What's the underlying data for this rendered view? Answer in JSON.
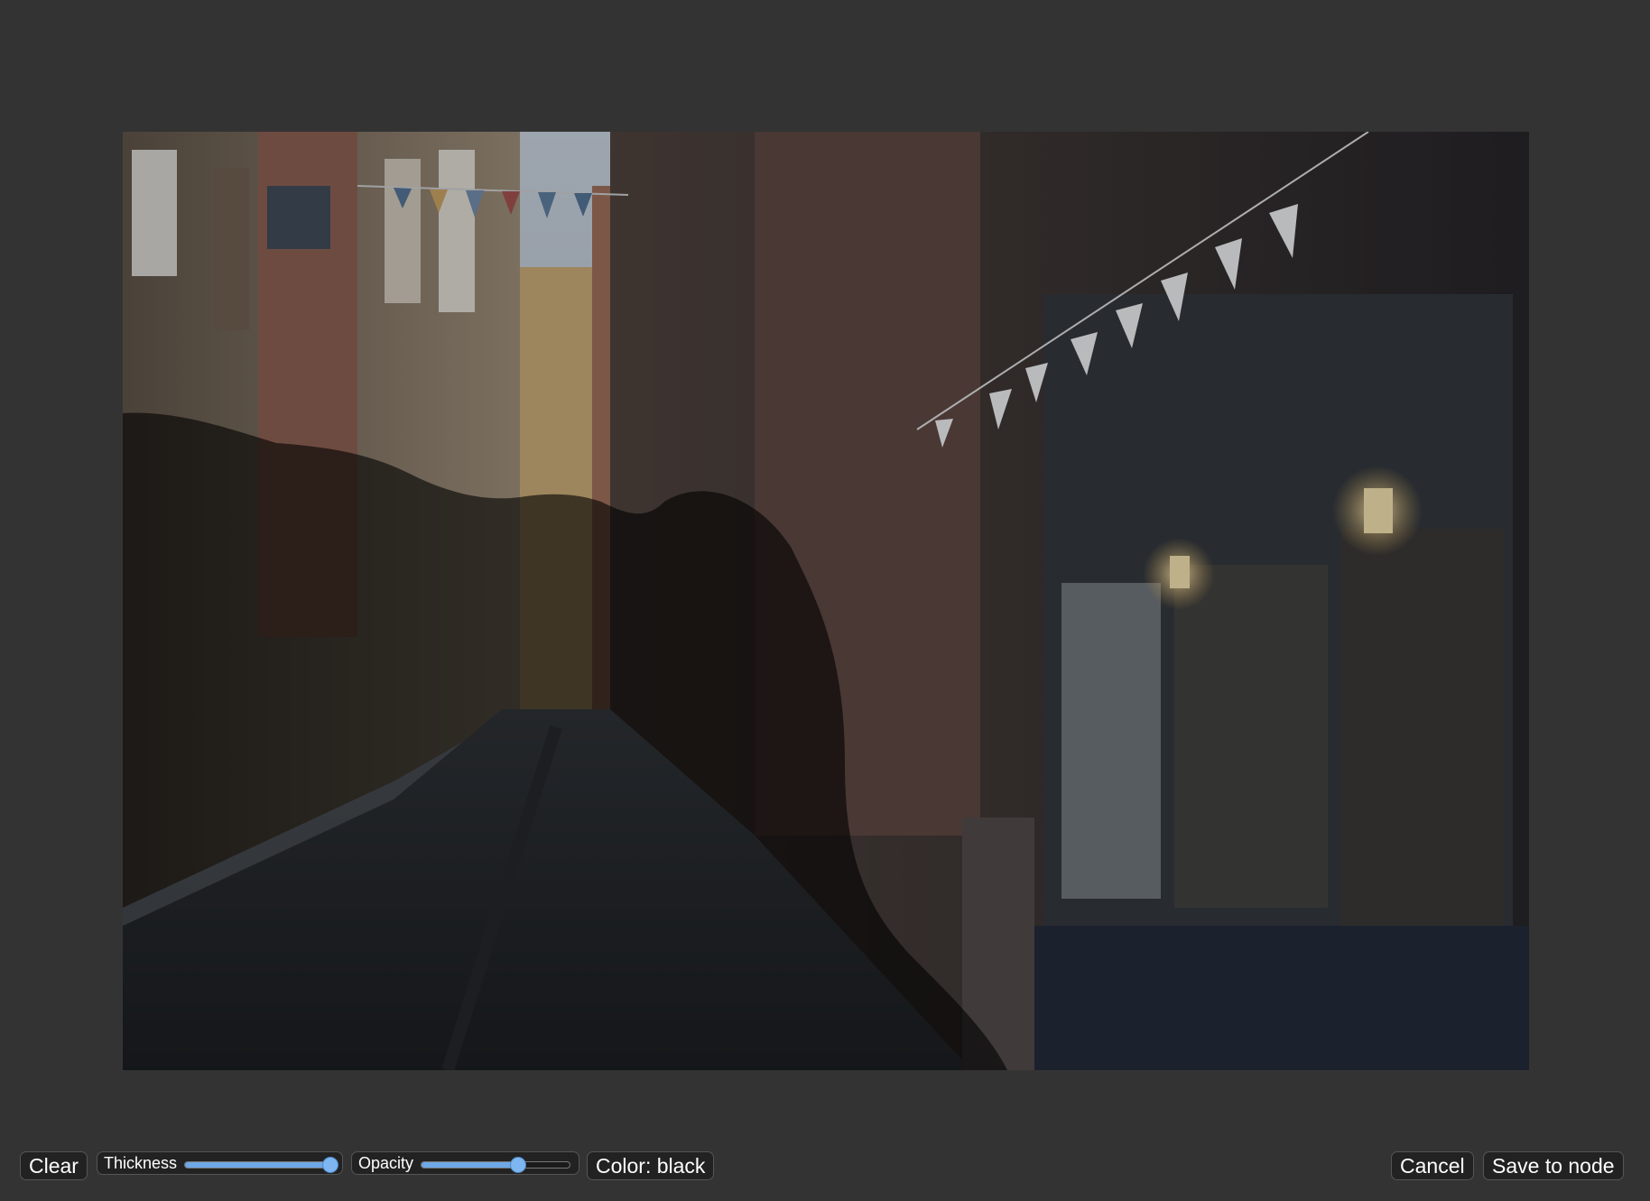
{
  "toolbar": {
    "clear_label": "Clear",
    "thickness": {
      "label": "Thickness",
      "value_fraction": 0.98
    },
    "opacity": {
      "label": "Opacity",
      "value_fraction": 0.65
    },
    "color_label": "Color: black",
    "cancel_label": "Cancel",
    "save_label": "Save to node"
  },
  "colors": {
    "background": "#333333",
    "button_bg": "#222222",
    "button_border": "#555555",
    "slider_fill": "#6ea8e6",
    "mask_color": "#000000"
  },
  "canvas": {
    "image_subject": "alley-street-photo",
    "mask_opacity": 0.65
  }
}
